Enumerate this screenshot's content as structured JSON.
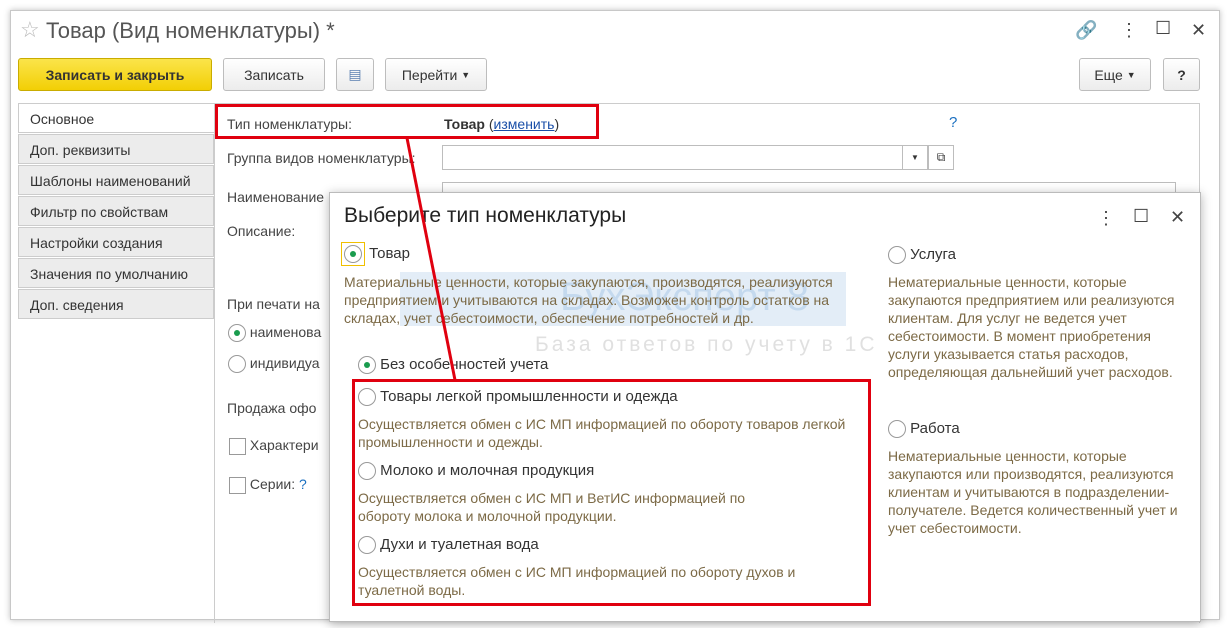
{
  "window": {
    "title": "Товар (Вид номенклатуры) *"
  },
  "toolbar": {
    "save_close": "Записать и закрыть",
    "save": "Записать",
    "goto": "Перейти",
    "more": "Еще",
    "help": "?"
  },
  "tabs": [
    "Основное",
    "Доп. реквизиты",
    "Шаблоны наименований",
    "Фильтр по свойствам",
    "Настройки создания",
    "Значения по умолчанию",
    "Доп. сведения"
  ],
  "form": {
    "type_label": "Тип номенклатуры:",
    "type_value": "Товар",
    "change_link": "изменить",
    "group_label": "Группа видов номенклатуры:",
    "name_label": "Наименование",
    "desc_label": "Описание:",
    "print_label": "При печати на",
    "radio1": "наименова",
    "radio2": "индивидуа",
    "sale_label": "Продажа офо",
    "char_label": "Характери",
    "series_label": "Серии:",
    "help": "?"
  },
  "dialog": {
    "title": "Выберите тип номенклатуры",
    "goods": {
      "label": "Товар",
      "desc": "Материальные ценности, которые закупаются, производятся, реализуются предприятием и учитываются на складах. Возможен контроль остатков на складах, учет себестоимости, обеспечение потребностей и др."
    },
    "sub": [
      {
        "label": "Без особенностей учета",
        "desc": "",
        "selected": true
      },
      {
        "label": "Товары легкой промышленности и одежда",
        "desc": "Осуществляется обмен с ИС МП информацией по обороту товаров легкой промышленности и одежды.",
        "selected": false
      },
      {
        "label": "Молоко и молочная продукция",
        "desc": "Осуществляется обмен с ИС МП и ВетИС информацией по обороту молока и молочной продукции.",
        "selected": false
      },
      {
        "label": "Духи и туалетная вода",
        "desc": "Осуществляется обмен с ИС МП информацией по обороту духов и туалетной воды.",
        "selected": false
      }
    ],
    "service": {
      "label": "Услуга",
      "desc": "Нематериальные ценности, которые закупаются предприятием или реализуются клиентам. Для услуг не ведется учет себестоимости. В момент приобретения услуги указывается статья расходов, определяющая дальнейший учет расходов."
    },
    "work": {
      "label": "Работа",
      "desc": "Нематериальные ценности, которые закупаются или производятся, реализуются клиентам и учитываются в подразделении-получателе. Ведется количественный учет и учет себестоимости."
    }
  },
  "watermark": {
    "brand": "БухЭксперт 8",
    "tagline": "База ответов по учету в 1С"
  },
  "colors": {
    "accent": "#f2cf05",
    "highlight": "#e0000f",
    "radio": "#1a9c4e"
  }
}
